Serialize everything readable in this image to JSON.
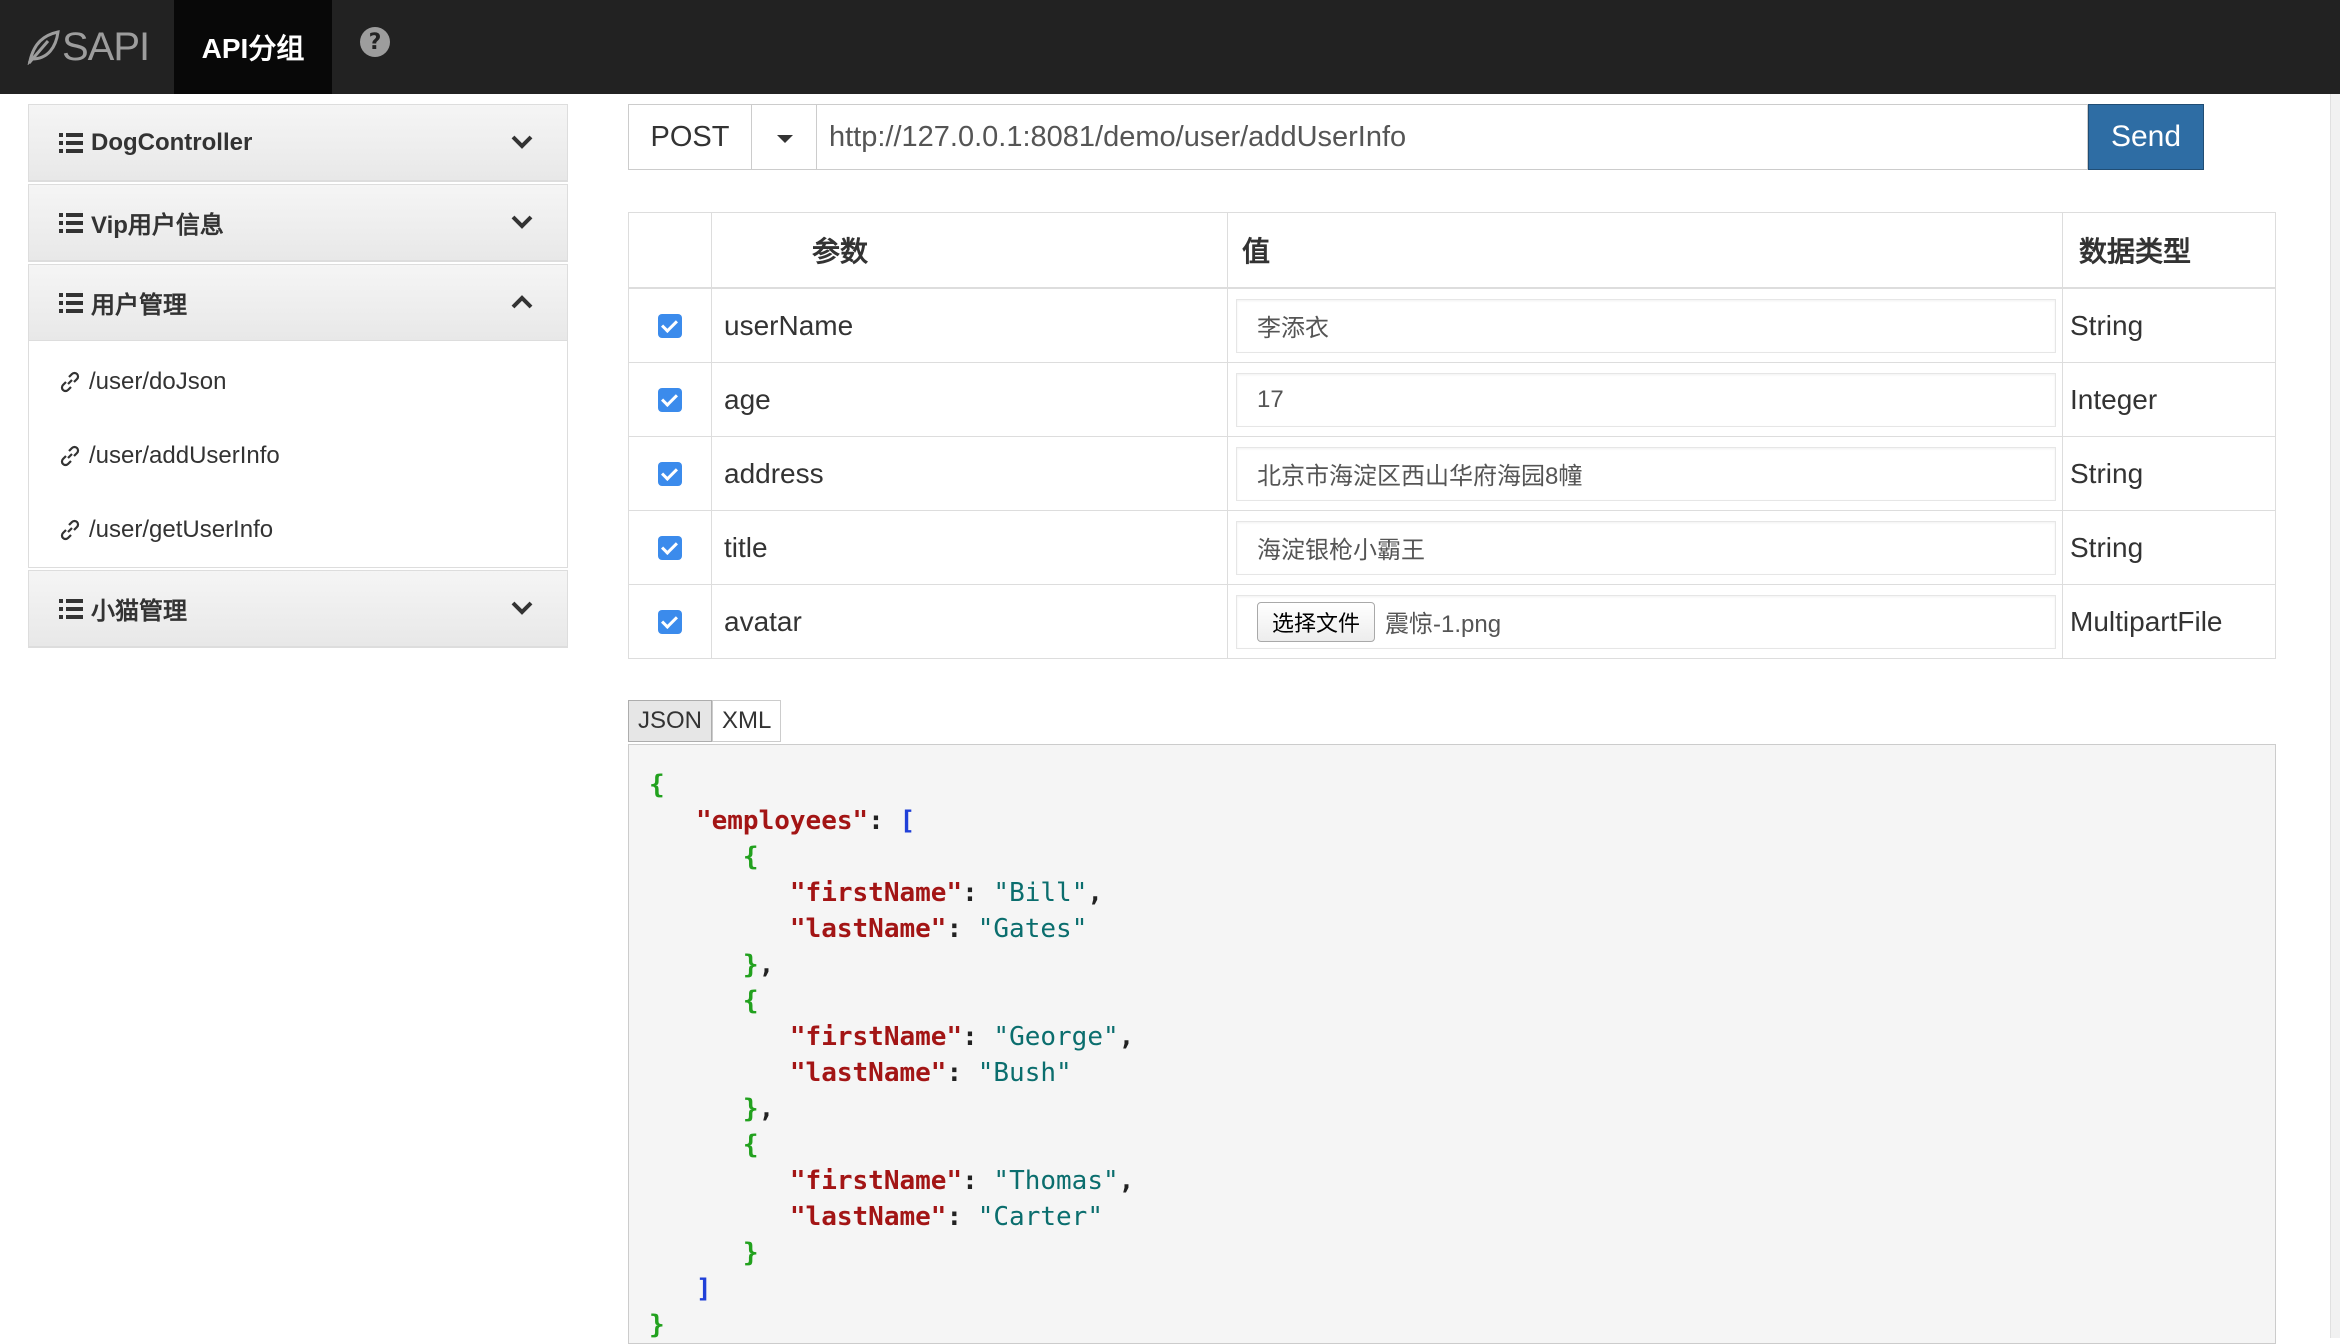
{
  "navbar": {
    "brand": "SAPI",
    "tab_label": "API分组",
    "help_icon": "question-circle-icon"
  },
  "sidebar": {
    "groups": [
      {
        "label": "DogController",
        "expanded": false
      },
      {
        "label": "Vip用户信息",
        "expanded": false
      },
      {
        "label": "用户管理",
        "expanded": true,
        "routes": [
          "/user/doJson",
          "/user/addUserInfo",
          "/user/getUserInfo"
        ]
      },
      {
        "label": "小猫管理",
        "expanded": false
      }
    ]
  },
  "request": {
    "method": "POST",
    "url": "http://127.0.0.1:8081/demo/user/addUserInfo",
    "send_label": "Send",
    "send_color": "#2e6da4"
  },
  "params": {
    "headers": {
      "name": "参数",
      "value": "值",
      "type": "数据类型"
    },
    "rows": [
      {
        "checked": true,
        "name": "userName",
        "value": "李添衣",
        "type": "String"
      },
      {
        "checked": true,
        "name": "age",
        "value": "17",
        "type": "Integer"
      },
      {
        "checked": true,
        "name": "address",
        "value": "北京市海淀区西山华府海园8幢",
        "type": "String"
      },
      {
        "checked": true,
        "name": "title",
        "value": "海淀银枪小霸王",
        "type": "String"
      },
      {
        "checked": true,
        "name": "avatar",
        "file_button": "选择文件",
        "value": "震惊-1.png",
        "type": "MultipartFile"
      }
    ]
  },
  "body_tabs": {
    "json": "JSON",
    "xml": "XML",
    "active": "JSON"
  },
  "body": {
    "root_key": "employees",
    "field_first": "firstName",
    "field_last": "lastName",
    "employees": [
      {
        "firstName": "Bill",
        "lastName": "Gates"
      },
      {
        "firstName": "George",
        "lastName": "Bush"
      },
      {
        "firstName": "Thomas",
        "lastName": "Carter"
      }
    ]
  }
}
